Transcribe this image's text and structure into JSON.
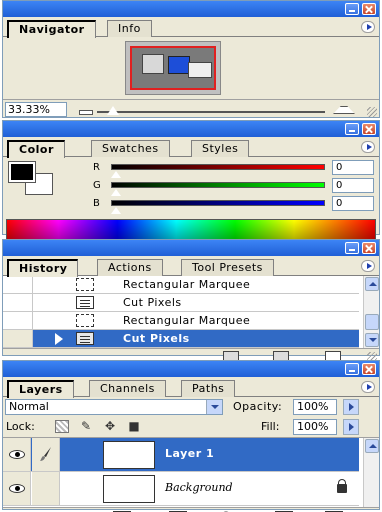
{
  "navigator": {
    "tabs": [
      "Navigator",
      "Info"
    ],
    "zoom": "33.33%"
  },
  "color": {
    "tabs": [
      "Color",
      "Swatches",
      "Styles"
    ],
    "channels": [
      {
        "label": "R",
        "value": "0",
        "color": "#e01818"
      },
      {
        "label": "G",
        "value": "0",
        "color": "#18c018"
      },
      {
        "label": "B",
        "value": "0",
        "color": "#1818e0"
      }
    ],
    "foreground": "#000000",
    "background": "#ffffff"
  },
  "history": {
    "tabs": [
      "History",
      "Actions",
      "Tool Presets"
    ],
    "items": [
      {
        "label": "Rectangular Marquee",
        "icon": "marquee-icon"
      },
      {
        "label": "Cut Pixels",
        "icon": "document-icon"
      },
      {
        "label": "Rectangular Marquee",
        "icon": "marquee-icon"
      },
      {
        "label": "Cut Pixels",
        "icon": "document-icon",
        "selected": true
      }
    ]
  },
  "layers": {
    "tabs": [
      "Layers",
      "Channels",
      "Paths"
    ],
    "blend_mode": "Normal",
    "opacity_label": "Opacity:",
    "opacity": "100%",
    "lock_label": "Lock:",
    "fill_label": "Fill:",
    "fill": "100%",
    "items": [
      {
        "name": "Layer 1",
        "selected": true
      },
      {
        "name": "Background",
        "locked": true
      }
    ]
  },
  "accent": "#316ac5",
  "titlebar_color": "#2a6fe8"
}
